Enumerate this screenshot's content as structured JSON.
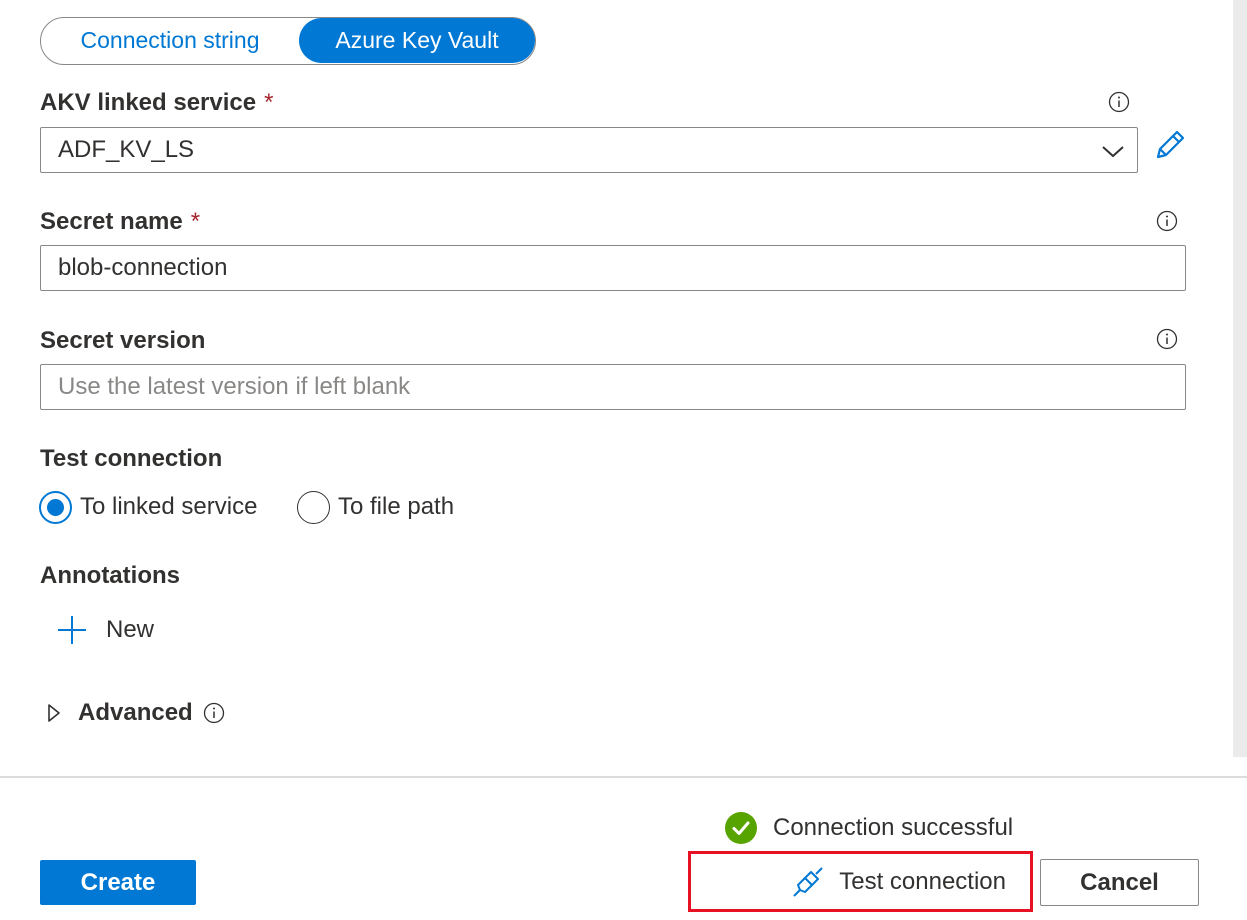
{
  "auth_toggle": {
    "options": [
      "Connection string",
      "Azure Key Vault"
    ],
    "selected": "Azure Key Vault"
  },
  "akv_linked_service": {
    "label": "AKV linked service",
    "required_mark": "*",
    "value": "ADF_KV_LS"
  },
  "secret_name": {
    "label": "Secret name",
    "required_mark": "*",
    "value": "blob-connection"
  },
  "secret_version": {
    "label": "Secret version",
    "value": "",
    "placeholder": "Use the latest version if left blank"
  },
  "test_connection_target": {
    "label": "Test connection",
    "options": [
      "To linked service",
      "To file path"
    ],
    "selected": "To linked service"
  },
  "annotations": {
    "label": "Annotations",
    "new_label": "New"
  },
  "advanced": {
    "label": "Advanced"
  },
  "footer": {
    "status_text": "Connection successful",
    "create_label": "Create",
    "test_connection_label": "Test connection",
    "cancel_label": "Cancel"
  },
  "colors": {
    "accent": "#0078d4",
    "success": "#57a300",
    "required": "#a4262c",
    "highlight_box": "#e81123"
  },
  "icons": [
    "info-icon",
    "chevron-down-icon",
    "edit-pencil-icon",
    "plus-icon",
    "caret-right-icon",
    "check-circle-icon",
    "plug-icon"
  ]
}
